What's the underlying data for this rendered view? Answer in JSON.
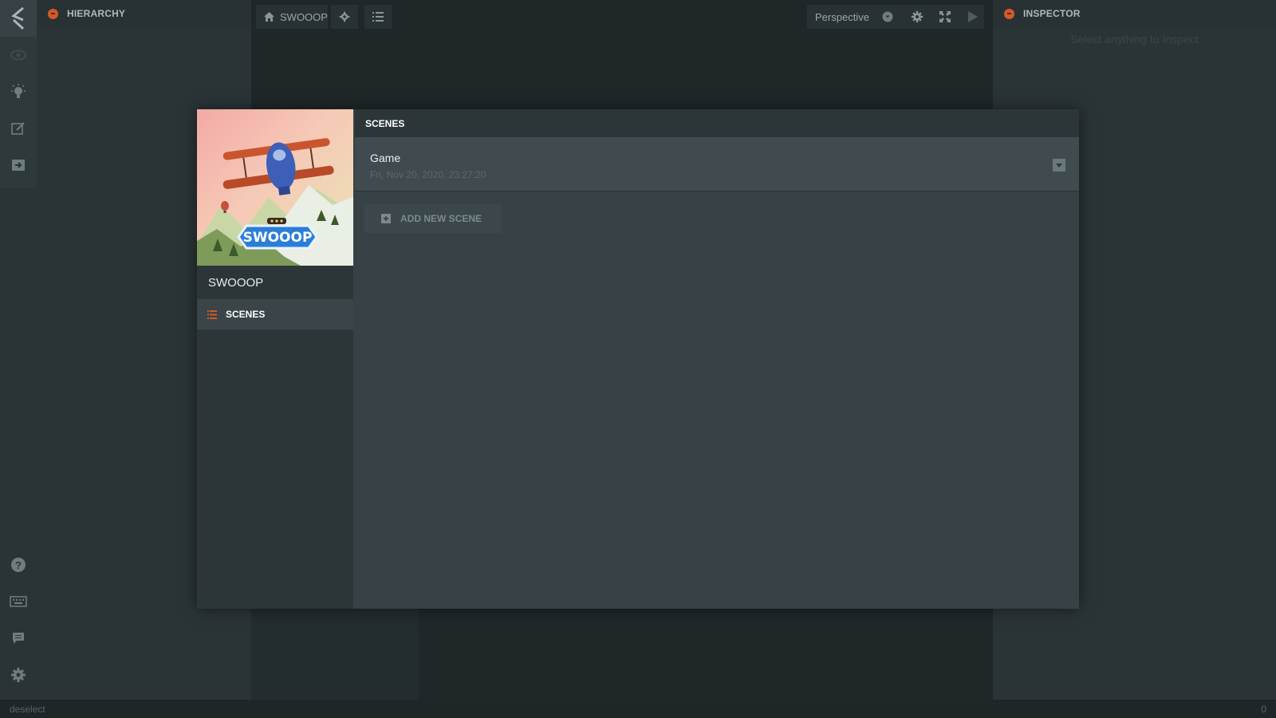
{
  "toolbar": {
    "logo_icon": "playcanvas-logo-icon",
    "top_icons": [
      "eye-icon",
      "lightbulb-icon",
      "edit-icon",
      "publish-icon"
    ],
    "bottom_icons": [
      "help-icon",
      "keyboard-icon",
      "chat-icon",
      "gear-icon"
    ]
  },
  "hierarchy": {
    "title": "HIERARCHY"
  },
  "viewport": {
    "project_label": "SWOOOP",
    "camera_label": "Perspective"
  },
  "inspector": {
    "title": "INSPECTOR",
    "hint": "Select anything to Inspect"
  },
  "statusbar": {
    "left_text": "deselect",
    "right_text": "0"
  },
  "modal": {
    "thumbnail_logo_text": "SWOOOP",
    "project_name": "SWOOOP",
    "nav": {
      "scenes_label": "SCENES"
    },
    "header": "SCENES",
    "scenes": [
      {
        "name": "Game",
        "date": "Fri, Nov 20, 2020, 23:27:20"
      }
    ],
    "add_scene_label": "ADD NEW SCENE"
  },
  "colors": {
    "accent": "#d4592a",
    "background": "#20292b",
    "panel": "#2a3436",
    "modal": "#364246"
  }
}
